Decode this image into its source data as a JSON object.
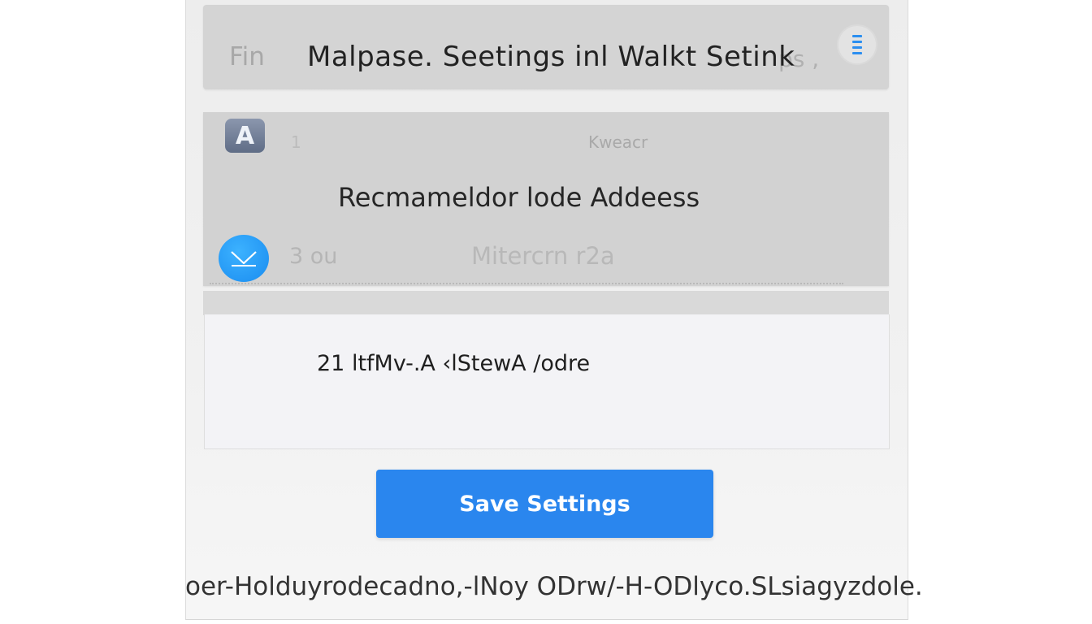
{
  "header": {
    "ghost_left": "Fin",
    "title": "Malpase. Seetings inl Walkt Setink",
    "ghost_right": "ps ,",
    "menu_icon": "hamburger-menu-icon"
  },
  "card": {
    "icon_letter": "A",
    "faded_number": "1",
    "faded_label": "Kweacr",
    "heading": "Recmameldor lode Addeess",
    "mail_icon": "mail-icon",
    "faded_left": "3 ou",
    "faded_mid": "Mitercrn r2a"
  },
  "field": {
    "value": "21  ltfMv-.A ‹lStewA /odre"
  },
  "actions": {
    "save_label": "Save Settings"
  },
  "footer": {
    "text": "oer-Holduyrodecadno,-lNoy ODrw/-H-ODlyco.SLsiagyzdole."
  },
  "colors": {
    "accent": "#2a86ee",
    "mail_icon": "#1a8cf0",
    "app_icon": "#6b7890"
  }
}
